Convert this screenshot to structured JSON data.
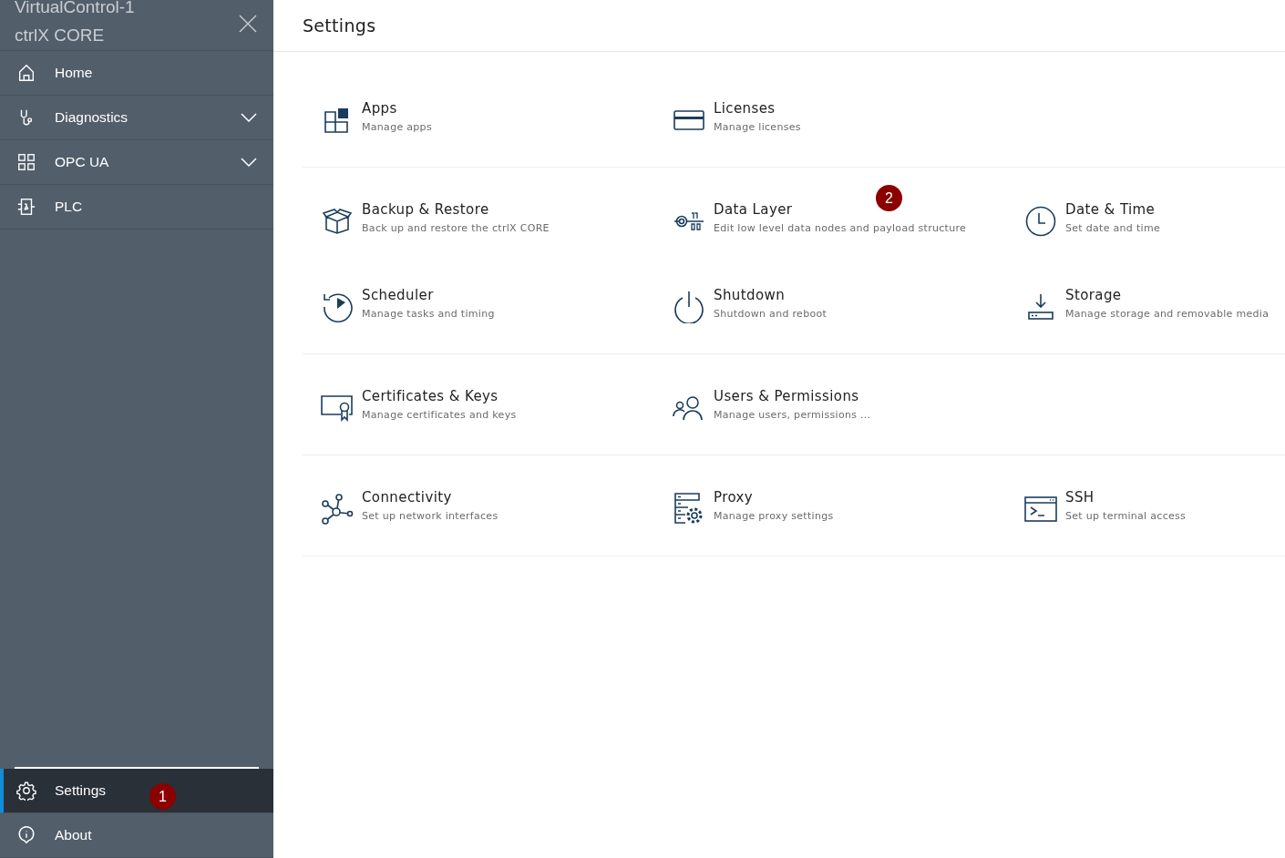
{
  "sidebar": {
    "device_name": "VirtualControl-1",
    "product": "ctrlX CORE",
    "items": [
      {
        "label": "Home",
        "kind": "link",
        "selected": false
      },
      {
        "label": "Diagnostics",
        "kind": "group",
        "expanded": false,
        "selected": false
      },
      {
        "label": "OPC UA",
        "kind": "group",
        "expanded": false,
        "selected": false
      },
      {
        "label": "PLC",
        "kind": "link",
        "selected": false
      }
    ],
    "bottom_items": [
      {
        "label": "Settings",
        "selected": true,
        "badge": "1"
      },
      {
        "label": "About",
        "selected": false
      }
    ]
  },
  "page": {
    "title": "Settings",
    "groups": [
      {
        "tiles": [
          {
            "title": "Apps",
            "subtitle": "Manage apps"
          },
          {
            "title": "Licenses",
            "subtitle": "Manage licenses"
          }
        ]
      },
      {
        "tiles": [
          {
            "title": "Backup & Restore",
            "subtitle": "Back up and restore the ctrlX CORE"
          },
          {
            "title": "Data Layer",
            "subtitle": "Edit low level data nodes and payload structure",
            "badge": "2"
          },
          {
            "title": "Date & Time",
            "subtitle": "Set date and time"
          },
          {
            "title": "Scheduler",
            "subtitle": "Manage tasks and timing"
          },
          {
            "title": "Shutdown",
            "subtitle": "Shutdown and reboot"
          },
          {
            "title": "Storage",
            "subtitle": "Manage storage and removable media"
          }
        ]
      },
      {
        "tiles": [
          {
            "title": "Certificates & Keys",
            "subtitle": "Manage certificates and keys"
          },
          {
            "title": "Users & Permissions",
            "subtitle": "Manage users, permissions ..."
          }
        ]
      },
      {
        "tiles": [
          {
            "title": "Connectivity",
            "subtitle": "Set up network interfaces"
          },
          {
            "title": "Proxy",
            "subtitle": "Manage proxy settings"
          },
          {
            "title": "SSH",
            "subtitle": "Set up terminal access"
          }
        ]
      }
    ]
  }
}
